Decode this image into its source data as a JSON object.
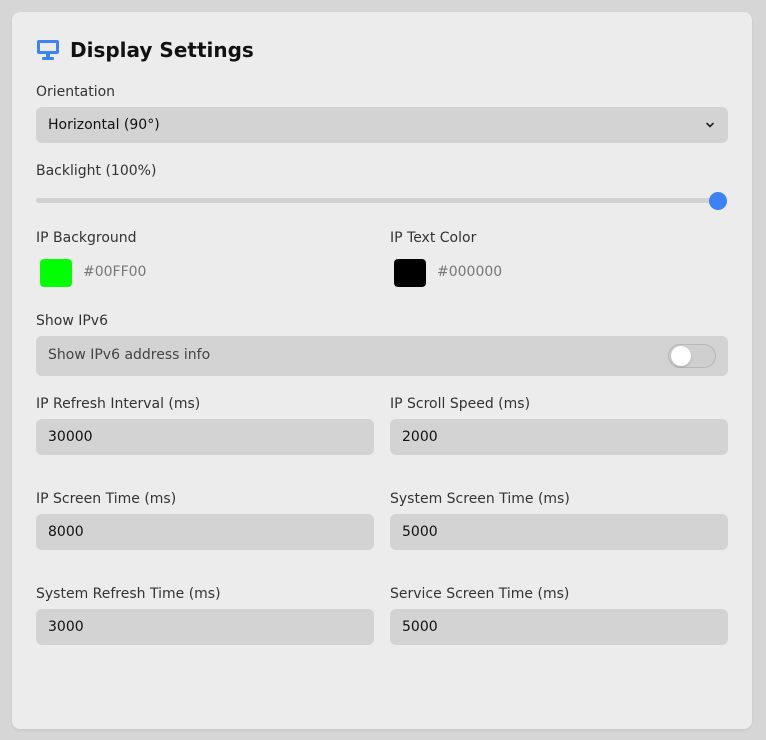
{
  "header": {
    "title": "Display Settings",
    "icon": "monitor-icon",
    "icon_color": "#3b82f6"
  },
  "orientation": {
    "label": "Orientation",
    "value": "Horizontal (90°)"
  },
  "backlight": {
    "label": "Backlight (100%)",
    "value_percent": 100,
    "accent": "#3b82f6"
  },
  "ip_background": {
    "label": "IP Background",
    "color": "#00FF00",
    "hex": "#00FF00"
  },
  "ip_text_color": {
    "label": "IP Text Color",
    "color": "#000000",
    "hex": "#000000"
  },
  "show_ipv6": {
    "label": "Show IPv6",
    "toggle_label": "Show IPv6 address info",
    "enabled": false
  },
  "ip_refresh_interval": {
    "label": "IP Refresh Interval (ms)",
    "value": "30000"
  },
  "ip_scroll_speed": {
    "label": "IP Scroll Speed (ms)",
    "value": "2000"
  },
  "ip_screen_time": {
    "label": "IP Screen Time (ms)",
    "value": "8000"
  },
  "system_screen_time": {
    "label": "System Screen Time (ms)",
    "value": "5000"
  },
  "system_refresh_time": {
    "label": "System Refresh Time (ms)",
    "value": "3000"
  },
  "service_screen_time": {
    "label": "Service Screen Time (ms)",
    "value": "5000"
  }
}
